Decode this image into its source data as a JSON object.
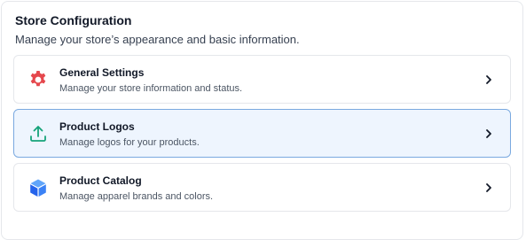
{
  "header": {
    "title": "Store Configuration",
    "subtitle": "Manage your store’s appearance and basic information."
  },
  "cards": [
    {
      "title": "General Settings",
      "description": "Manage your store information and status.",
      "icon": "gear-icon",
      "icon_color": "#e5484d",
      "active": false
    },
    {
      "title": "Product Logos",
      "description": "Manage logos for your products.",
      "icon": "upload-icon",
      "icon_color": "#16a37a",
      "active": true
    },
    {
      "title": "Product Catalog",
      "description": "Manage apparel brands and colors.",
      "icon": "cube-icon",
      "icon_color": "#3b82f6",
      "active": false
    }
  ]
}
